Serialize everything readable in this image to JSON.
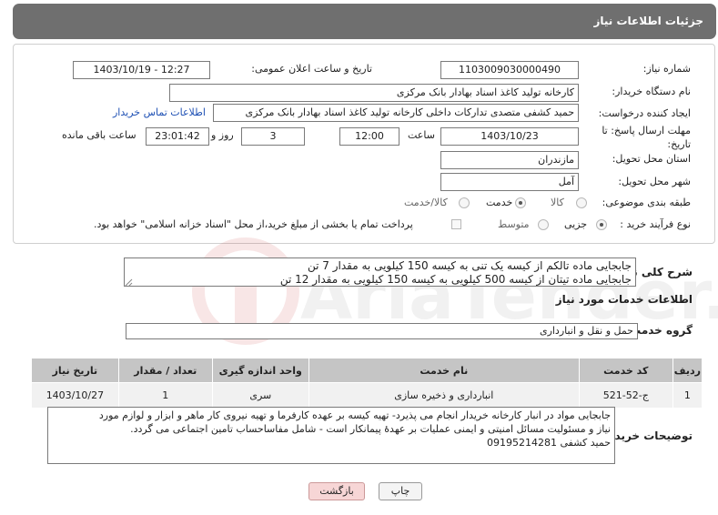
{
  "header": {
    "title": "جزئیات اطلاعات نیاز"
  },
  "form": {
    "need_number_label": "شماره نیاز:",
    "need_number": "1103009030000490",
    "announce_label": "تاریخ و ساعت اعلان عمومی:",
    "announce_value": "1403/10/19 - 12:27",
    "buyer_org_label": "نام دستگاه خریدار:",
    "buyer_org": "کارخانه تولید کاغذ اسناد بهادار بانک مرکزی",
    "requester_label": "ایجاد کننده درخواست:",
    "requester": "حمید کشفی متصدی تدارکات داخلی کارخانه تولید کاغذ اسناد بهادار بانک مرکزی",
    "buyer_contact_link": "اطلاعات تماس خریدار",
    "deadline_label": "مهلت ارسال پاسخ: تا تاریخ:",
    "deadline_date": "1403/10/23",
    "time_label": "ساعت",
    "deadline_time": "12:00",
    "days_value": "3",
    "days_label": "روز و",
    "remaining_time": "23:01:42",
    "remaining_label": "ساعت باقی مانده",
    "province_label": "استان محل تحویل:",
    "province": "مازندران",
    "city_label": "شهر محل تحویل:",
    "city": "آمل",
    "category_label": "طبقه بندی موضوعی:",
    "category_options": [
      "کالا",
      "خدمت",
      "کالا/خدمت"
    ],
    "category_selected": "خدمت",
    "process_label": "نوع فرآیند خرید :",
    "process_options": [
      "جزیی",
      "متوسط"
    ],
    "process_selected": "جزیی",
    "treasury_note": "پرداخت تمام یا بخشی از مبلغ خرید،از محل \"اسناد خزانه اسلامی\" خواهد بود."
  },
  "summary": {
    "label": "شرح کلی نیاز:",
    "line1": "جابجایی ماده تالکم از کیسه یک تنی به کیسه 150 کیلویی به مقدار 7 تن",
    "line2": "جابجایی ماده تیتان از کیسه 500 کیلویی به کیسه 150 کیلویی به مقدار 12 تن"
  },
  "services": {
    "section_title": "اطلاعات خدمات مورد نیاز",
    "group_label": "گروه خدمت:",
    "group_value": "حمل و نقل و انبارداری",
    "columns": [
      "ردیف",
      "کد خدمت",
      "نام خدمت",
      "واحد اندازه گیری",
      "تعداد / مقدار",
      "تاریخ نیاز"
    ],
    "rows": [
      [
        "1",
        "ج-52-521",
        "انبارداری و ذخیره سازی",
        "سری",
        "1",
        "1403/10/27"
      ]
    ]
  },
  "buyer_desc": {
    "label": "توضیحات خریدار:",
    "line1": "جابجایی مواد در انبار کارخانه خریدار انجام می پذیرد- تهیه کیسه بر عهده کارفرما و تهیه نیروی کار ماهر و ابزار و لوازم مورد",
    "line2": "نیاز و مسئولیت مسائل امنیتی و ایمنی عملیات بر عهدۀ پیمانکار است - شامل مفاساحساب تامین اجتماعی می گردد.",
    "line3": "حمید کشفی 09195214281"
  },
  "buttons": {
    "print": "چاپ",
    "back": "بازگشت"
  },
  "watermark_text": "AriaTender.neT",
  "colors": {
    "titlebar": "#6f6f6f",
    "table_header": "#c5c5c5",
    "link": "#1e50b4",
    "back_button": "#f7d6d6"
  }
}
